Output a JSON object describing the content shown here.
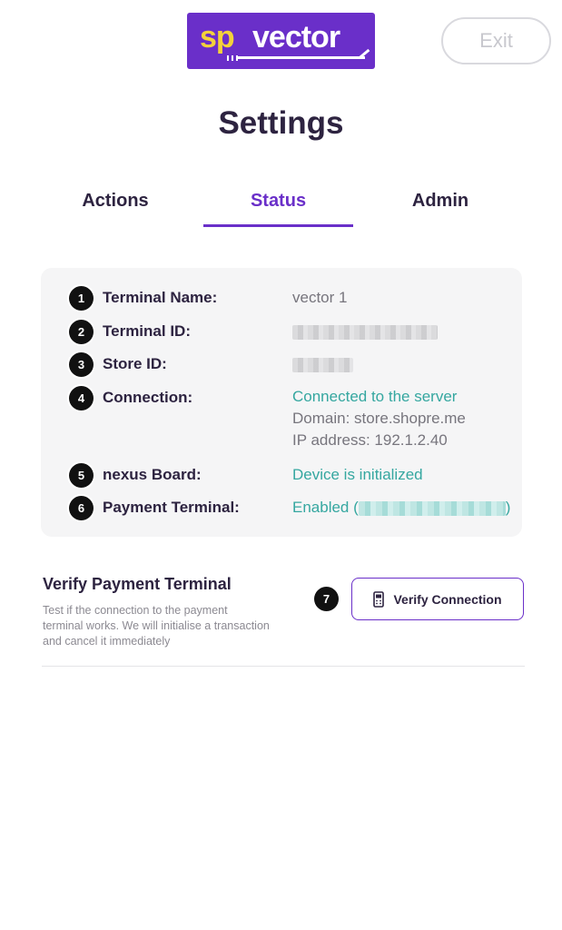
{
  "header": {
    "logo_sp": "sp",
    "logo_vector": "vector",
    "exit_label": "Exit"
  },
  "page": {
    "title": "Settings"
  },
  "tabs": [
    {
      "label": "Actions",
      "active": false
    },
    {
      "label": "Status",
      "active": true
    },
    {
      "label": "Admin",
      "active": false
    }
  ],
  "status": {
    "rows": [
      {
        "badge": "1",
        "label": "Terminal Name:",
        "value": "vector 1"
      },
      {
        "badge": "2",
        "label": "Terminal ID:"
      },
      {
        "badge": "3",
        "label": "Store ID:"
      },
      {
        "badge": "4",
        "label": "Connection:",
        "value": "Connected to the server",
        "domain": "Domain: store.shopre.me",
        "ip": "IP address: 192.1.2.40"
      },
      {
        "badge": "5",
        "label": "nexus Board:",
        "value": "Device is initialized"
      },
      {
        "badge": "6",
        "label": "Payment Terminal:",
        "value_prefix": "Enabled (",
        "value_suffix": ")"
      }
    ]
  },
  "verify": {
    "title": "Verify Payment Terminal",
    "description": "Test if the connection to the payment terminal works. We will initialise a transaction and cancel it immediately",
    "badge": "7",
    "button_label": "Verify Connection"
  },
  "colors": {
    "brand_purple": "#6a2fc9",
    "logo_yellow": "#f3d23a",
    "status_teal": "#35a7a0",
    "text_dark": "#2d2340"
  }
}
